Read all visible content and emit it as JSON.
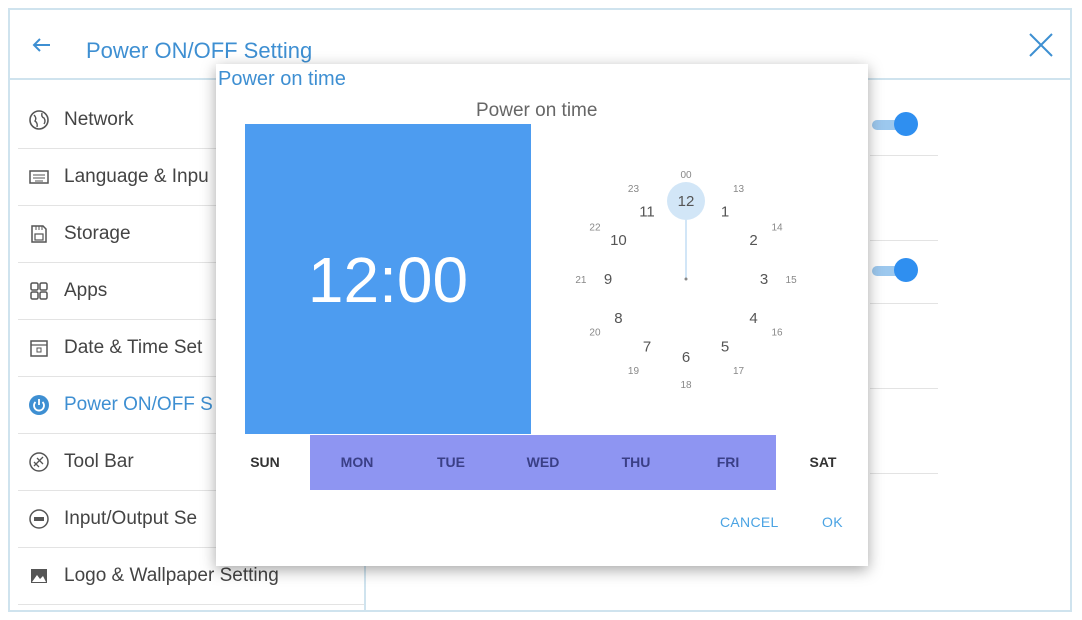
{
  "header": {
    "title": "Power ON/OFF Setting"
  },
  "sidebar": {
    "items": [
      {
        "label": "Network",
        "icon": "globe-icon"
      },
      {
        "label": "Language & Inpu",
        "icon": "keyboard-icon"
      },
      {
        "label": "Storage",
        "icon": "storage-icon"
      },
      {
        "label": "Apps",
        "icon": "apps-icon"
      },
      {
        "label": "Date & Time Set",
        "icon": "calendar-icon"
      },
      {
        "label": "Power ON/OFF S",
        "icon": "power-icon",
        "active": true
      },
      {
        "label": "Tool Bar",
        "icon": "toolbar-icon"
      },
      {
        "label": "Input/Output Se",
        "icon": "input-output-icon"
      },
      {
        "label": "Logo & Wallpaper Setting",
        "icon": "wallpaper-icon"
      }
    ]
  },
  "dialog": {
    "heading": "Power on time",
    "subtitle": "Power on time",
    "time": "12:00",
    "clock": {
      "outer": [
        "1",
        "2",
        "3",
        "4",
        "5",
        "6",
        "7",
        "8",
        "9",
        "10",
        "11",
        "12"
      ],
      "inner": [
        "13",
        "14",
        "15",
        "16",
        "17",
        "18",
        "19",
        "20",
        "21",
        "22",
        "23",
        "00"
      ],
      "selected": "12"
    },
    "days": [
      {
        "label": "SUN",
        "on": false
      },
      {
        "label": "MON",
        "on": true
      },
      {
        "label": "TUE",
        "on": true
      },
      {
        "label": "WED",
        "on": true
      },
      {
        "label": "THU",
        "on": true
      },
      {
        "label": "FRI",
        "on": true
      },
      {
        "label": "SAT",
        "on": false
      }
    ],
    "cancel_label": "CANCEL",
    "ok_label": "OK"
  },
  "colors": {
    "accent": "#3e8fd2",
    "time_panel": "#4d9cf0",
    "selected_days": "#8e95f2",
    "toggle_on": "#2f8ff0"
  },
  "toggles": [
    {
      "state": "on"
    },
    {
      "state": "on"
    }
  ]
}
